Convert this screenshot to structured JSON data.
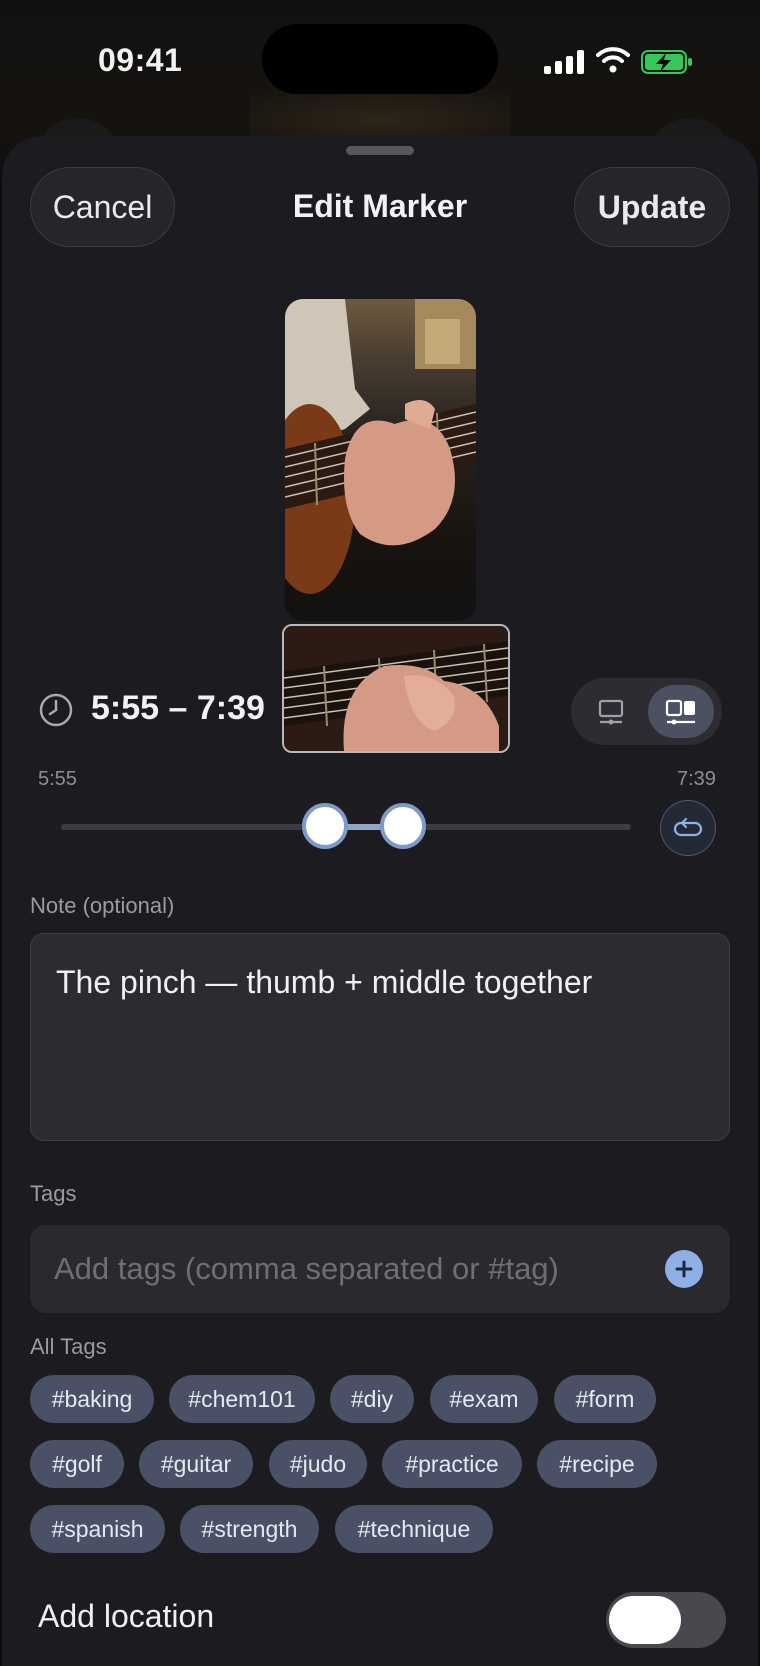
{
  "status_bar": {
    "time": "09:41"
  },
  "header": {
    "title": "Edit Marker",
    "cancel_label": "Cancel",
    "update_label": "Update"
  },
  "marker": {
    "range_text": "5:55 – 7:39",
    "range_start": "5:55",
    "range_end": "7:39"
  },
  "note": {
    "label": "Note (optional)",
    "value": "The pinch — thumb + middle together"
  },
  "tags": {
    "label": "Tags",
    "input_placeholder": "Add tags (comma separated or #tag)",
    "all_tags_label": "All Tags",
    "chips": [
      "#baking",
      "#chem101",
      "#diy",
      "#exam",
      "#form",
      "#golf",
      "#guitar",
      "#judo",
      "#practice",
      "#recipe",
      "#spanish",
      "#strength",
      "#technique"
    ]
  },
  "location": {
    "label": "Add location",
    "enabled": false
  },
  "colors": {
    "accent": "#8fb0e6",
    "chip_bg": "#4a5066",
    "sheet_bg": "#1b1b20"
  }
}
